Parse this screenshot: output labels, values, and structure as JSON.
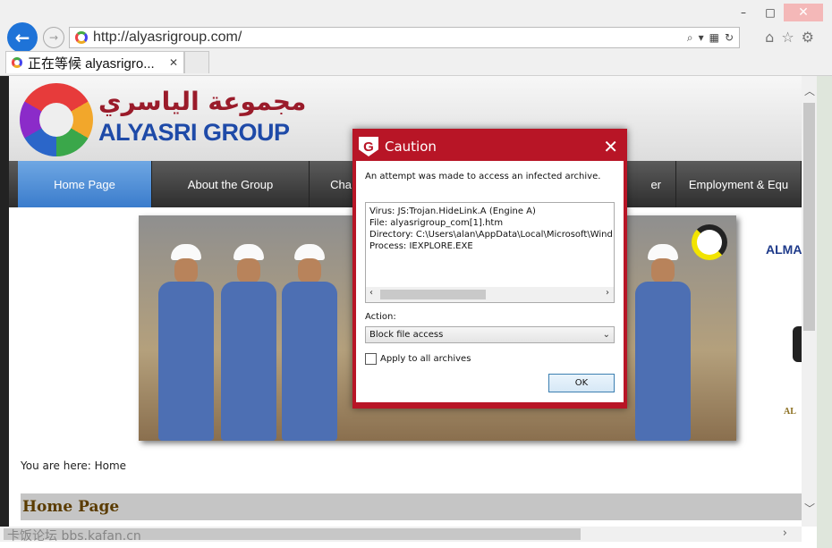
{
  "browser": {
    "url": "http://alyasrigroup.com/",
    "tab_label": "正在等候 alyasrigro...",
    "window_buttons": {
      "minimize": "–",
      "maximize": "□",
      "close": "✕"
    },
    "address_icons": [
      "search-icon",
      "dropdown-icon",
      "compatibility-icon",
      "refresh-icon"
    ],
    "tool_icons": [
      "home-icon",
      "star-icon",
      "gear-icon"
    ]
  },
  "site": {
    "logo_arabic": "مجموعة الياسري",
    "logo_latin": "ALYASRI GROUP",
    "nav": [
      {
        "label": "Home Page",
        "active": true
      },
      {
        "label": "About the Group",
        "active": false
      },
      {
        "label": "Cha",
        "active": false
      },
      {
        "label": "er",
        "active": false
      },
      {
        "label": "Employment & Equ",
        "active": false
      }
    ],
    "partner_logo_1": "ALMA",
    "partner_logo_3": "AL",
    "breadcrumb": "You are here: Home",
    "heading": "Home Page"
  },
  "watermark": "卡饭论坛 bbs.kafan.cn",
  "dialog": {
    "title": "Caution",
    "logo_letter": "G",
    "message": "An attempt was made to access an infected archive.",
    "details": [
      "Virus: JS:Trojan.HideLink.A (Engine A)",
      "File: alyasrigroup_com[1].htm",
      "Directory: C:\\Users\\alan\\AppData\\Local\\Microsoft\\Wind",
      "Process: IEXPLORE.EXE"
    ],
    "action_label": "Action:",
    "action_value": "Block file access",
    "apply_all_label": "Apply to all archives",
    "apply_all_checked": false,
    "ok_label": "OK"
  },
  "colors": {
    "dialog_red": "#b81526",
    "nav_active": "#3a7ccc",
    "logo_blue": "#1e4aa8",
    "logo_red": "#9a1b2a"
  }
}
